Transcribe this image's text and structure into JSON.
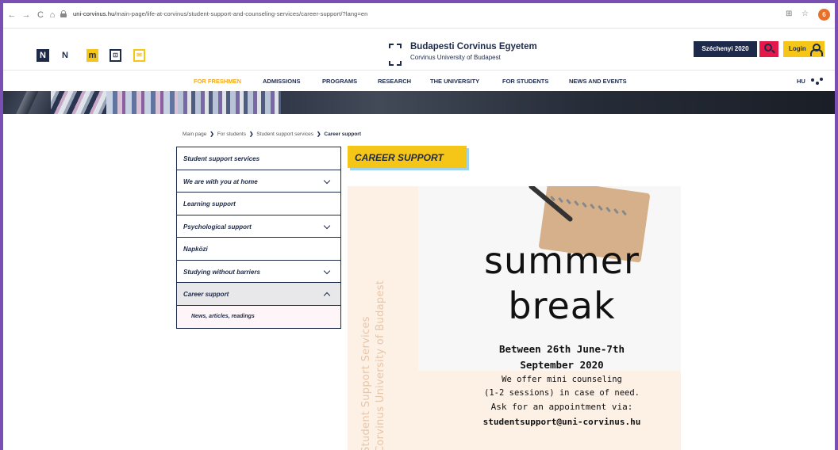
{
  "browser": {
    "back_icon": "arrow-left-icon",
    "forward_icon": "arrow-right-icon",
    "reload_icon": "reload-icon",
    "home_icon": "home-icon",
    "url_domain": "uni-corvinus.hu",
    "url_path": "/main-page/life-at-corvinus/student-support-and-counseling-services/career-support/?lang=en",
    "profile_initial": "6",
    "back_glyph": "←",
    "forward_glyph": "→",
    "reload_glyph": "C",
    "home_glyph": "⌂",
    "translate_glyph": "⊞",
    "star_glyph": "☆"
  },
  "header": {
    "quick_icons": [
      "N",
      "N",
      "m",
      "⊡",
      "✉"
    ],
    "logo_title": "Budapesti Corvinus Egyetem",
    "logo_subtitle": "Corvinus University of Budapest",
    "szechenyi_label": "Széchenyi 2020",
    "login_label": "Login",
    "colors": {
      "navy": "#1e2a4a",
      "yellow": "#f5c518",
      "pink": "#e5184b"
    }
  },
  "nav": {
    "items": [
      "FOR FRESHMEN",
      "ADMISSIONS",
      "PROGRAMS",
      "RESEARCH",
      "THE UNIVERSITY",
      "FOR STUDENTS",
      "NEWS AND EVENTS"
    ],
    "active_index": 0,
    "lang": "HU"
  },
  "breadcrumb": {
    "items": [
      "Main page",
      "For students",
      "Student support services"
    ],
    "current": "Career support",
    "separator": "❯"
  },
  "sidebar": {
    "items": [
      {
        "label": "Student support services",
        "chevron": "none"
      },
      {
        "label": "We are with you at home",
        "chevron": "down"
      },
      {
        "label": "Learning support",
        "chevron": "none"
      },
      {
        "label": "Psychological support",
        "chevron": "down"
      },
      {
        "label": "Napközi",
        "chevron": "none"
      },
      {
        "label": "Studying without barriers",
        "chevron": "down"
      },
      {
        "label": "Career support",
        "chevron": "up",
        "active": true
      }
    ],
    "subitems": [
      "News, articles, readings"
    ]
  },
  "page": {
    "title": "CAREER SUPPORT"
  },
  "poster": {
    "vertical_line1": "Student Support Services",
    "vertical_line2": "Corvinus University of Budapest",
    "headline1": "summer",
    "headline2": "break",
    "dates_line1": "Between 26th June-7th",
    "dates_line2": "September 2020",
    "line1": "We offer mini counseling",
    "line2": "(1-2 sessions) in case of need.",
    "line3": "Ask for an appointment via:",
    "email": "studentsupport@uni-corvinus.hu"
  }
}
